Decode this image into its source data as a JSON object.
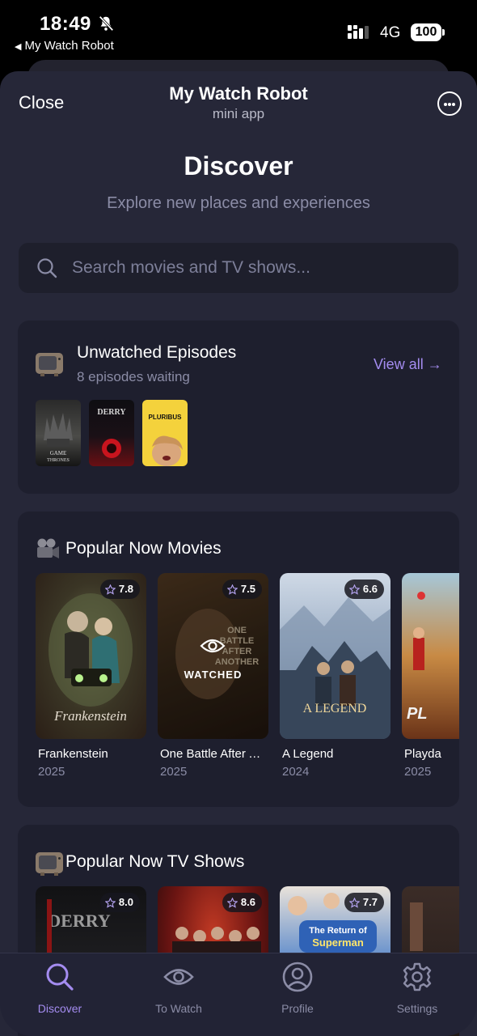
{
  "status_bar": {
    "time": "18:49",
    "back_app": "My Watch Robot",
    "network": "4G",
    "battery": "100"
  },
  "header": {
    "close_label": "Close",
    "title": "My Watch Robot",
    "subtitle": "mini app"
  },
  "page": {
    "title": "Discover",
    "subtitle": "Explore new places and experiences"
  },
  "search": {
    "placeholder": "Search movies and TV shows..."
  },
  "unwatched": {
    "title": "Unwatched Episodes",
    "subtitle": "8 episodes waiting",
    "view_all": "View all →",
    "thumbnails": [
      {
        "caption": "GAME OF THRONES"
      },
      {
        "caption": "DERRY"
      },
      {
        "caption": "PLURIBUS"
      }
    ]
  },
  "popular_movies": {
    "title": "Popular Now Movies",
    "items": [
      {
        "title": "Frankenstein",
        "year": "2025",
        "rating": "7.8",
        "poster_text": "Frankenstein",
        "watched": false
      },
      {
        "title": "One Battle After Another",
        "year": "2025",
        "rating": "7.5",
        "poster_text": "ONE BATTLE AFTER ANOTHER",
        "watched": true,
        "watched_label": "WATCHED"
      },
      {
        "title": "A Legend",
        "year": "2024",
        "rating": "6.6",
        "poster_text": "A LEGEND",
        "watched": false
      },
      {
        "title": "Playda",
        "year": "2025",
        "rating": "",
        "poster_text": "PL",
        "watched": false
      }
    ]
  },
  "popular_tv": {
    "title": "Popular Now TV Shows",
    "items": [
      {
        "rating": "8.0",
        "poster_text": "DERRY"
      },
      {
        "rating": "8.6",
        "poster_text": ""
      },
      {
        "rating": "7.7",
        "poster_text": "The Return of Superman"
      },
      {
        "rating": "",
        "poster_text": ""
      }
    ]
  },
  "bottom_nav": [
    {
      "label": "Discover",
      "icon": "search-icon",
      "active": true
    },
    {
      "label": "To Watch",
      "icon": "eye-icon",
      "active": false
    },
    {
      "label": "Profile",
      "icon": "user-icon",
      "active": false
    },
    {
      "label": "Settings",
      "icon": "gear-icon",
      "active": false
    }
  ],
  "colors": {
    "accent": "#a48cf0",
    "background": "#262738",
    "card": "#1e1f2e"
  }
}
